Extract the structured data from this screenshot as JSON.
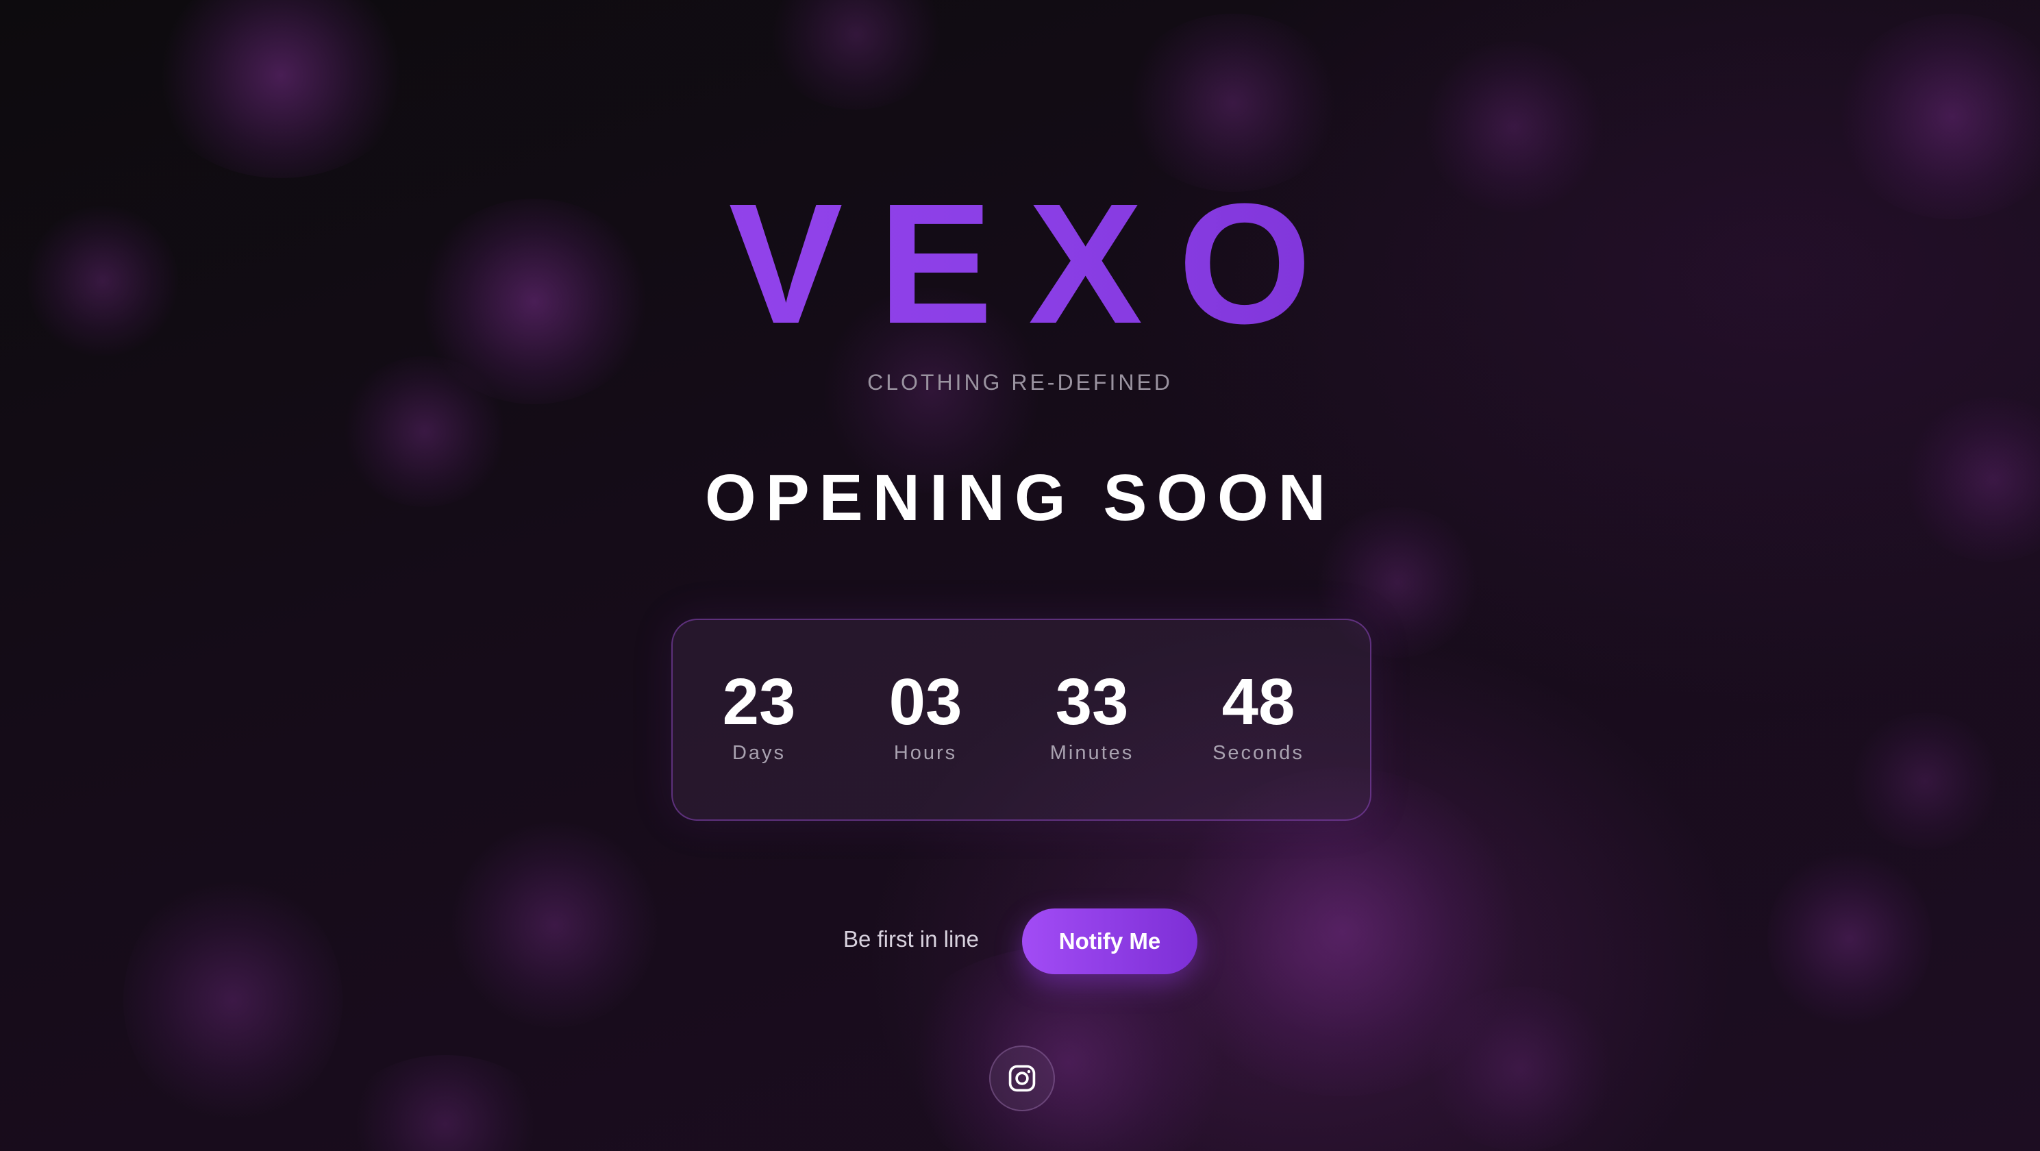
{
  "brand": {
    "logo": "VEXO",
    "tagline": "CLOTHING RE-DEFINED"
  },
  "headline": "OPENING SOON",
  "countdown": {
    "days": {
      "value": "23",
      "label": "Days"
    },
    "hours": {
      "value": "03",
      "label": "Hours"
    },
    "minutes": {
      "value": "33",
      "label": "Minutes"
    },
    "seconds": {
      "value": "48",
      "label": "Seconds"
    }
  },
  "cta": {
    "text": "Be first in line",
    "button_label": "Notify Me"
  },
  "social": {
    "icon": "instagram-icon"
  },
  "colors": {
    "background": "#120b14",
    "accent": "#a24cf5",
    "accent_dark": "#6a22c0",
    "text": "#ffffff",
    "muted": "#9a93a0"
  }
}
